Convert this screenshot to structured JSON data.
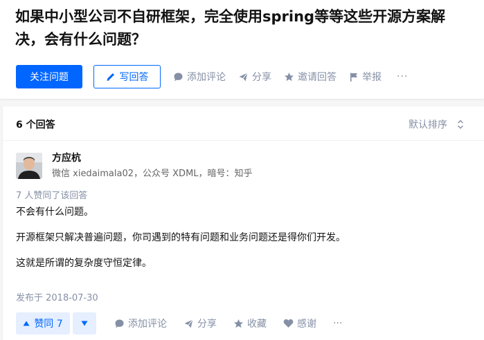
{
  "question": {
    "title": "如果中小型公司不自研框架，完全使用spring等等这些开源方案解决，会有什么问题？",
    "actions": {
      "follow_label": "关注问题",
      "write_label": "写回答",
      "comment_label": "添加评论",
      "share_label": "分享",
      "invite_label": "邀请回答",
      "report_label": "举报",
      "more_label": "···"
    }
  },
  "answers": {
    "count_label": "6 个回答",
    "sort_label": "默认排序",
    "items": [
      {
        "author_name": "方应杭",
        "author_headline": "微信 xiedaimala02，公众号 XDML，暗号：知乎",
        "vote_summary": "7 人赞同了该回答",
        "paragraphs": [
          "不会有什么问题。",
          "开源框架只解决普遍问题，你司遇到的特有问题和业务问题还是得你们开发。",
          "这就是所谓的复杂度守恒定律。"
        ],
        "date": "发布于 2018-07-30",
        "actions": {
          "upvote_label": "赞同 7",
          "comment_label": "添加评论",
          "share_label": "分享",
          "collect_label": "收藏",
          "thanks_label": "感谢",
          "more_label": "···"
        }
      }
    ]
  },
  "colors": {
    "brand_blue": "#0066ff",
    "vote_bg": "#e5efff",
    "muted_text": "#8590a6",
    "background": "#f6f6f6"
  },
  "icons": [
    "pencil-icon",
    "comment-icon",
    "share-icon",
    "star-icon",
    "flag-icon",
    "sort-icon",
    "upvote-triangle-icon",
    "downvote-triangle-icon",
    "heart-icon"
  ]
}
